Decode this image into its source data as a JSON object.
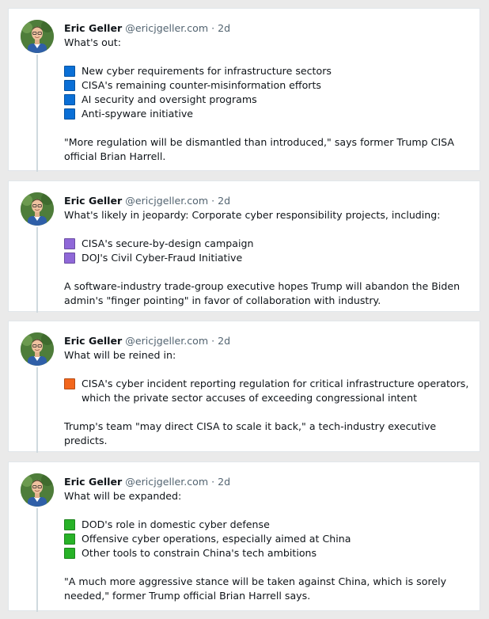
{
  "author": {
    "name": "Eric Geller",
    "handle": "@ericjgeller.com",
    "separator": "·",
    "time": "2d",
    "avatar_icon": "profile-photo"
  },
  "colors": {
    "blue": "#0a6fd6",
    "purple": "#8f68d8",
    "orange": "#f2661c",
    "green": "#27b227",
    "muted_text": "#536471"
  },
  "posts": [
    {
      "intro": "What's out:",
      "bullet_color": "blue",
      "bullets": [
        "New cyber requirements for infrastructure sectors",
        "CISA's remaining counter-misinformation efforts",
        "AI security and oversight programs",
        "Anti-spyware initiative"
      ],
      "closing": "\"More regulation will be dismantled than introduced,\" says former Trump CISA official Brian Harrell."
    },
    {
      "intro": "What's likely in jeopardy: Corporate cyber responsibility projects, including:",
      "bullet_color": "purple",
      "bullets": [
        "CISA's secure-by-design campaign",
        "DOJ's Civil Cyber-Fraud Initiative"
      ],
      "closing": "A software-industry trade-group executive hopes Trump will abandon the Biden admin's \"finger pointing\" in favor of collaboration with industry."
    },
    {
      "intro": "What will be reined in:",
      "bullet_color": "orange",
      "bullets": [
        "CISA's cyber incident reporting regulation for critical infrastructure operators, which the private sector accuses of exceeding congressional intent"
      ],
      "closing": "Trump's team \"may direct CISA to scale it back,\" a tech-industry executive predicts."
    },
    {
      "intro": "What will be expanded:",
      "bullet_color": "green",
      "bullets": [
        "DOD's role in domestic cyber defense",
        "Offensive cyber operations, especially aimed at China",
        "Other tools to constrain China's tech ambitions"
      ],
      "closing": "\"A much more aggressive stance will be taken against China, which is sorely needed,\" former Trump official Brian Harrell says."
    }
  ]
}
